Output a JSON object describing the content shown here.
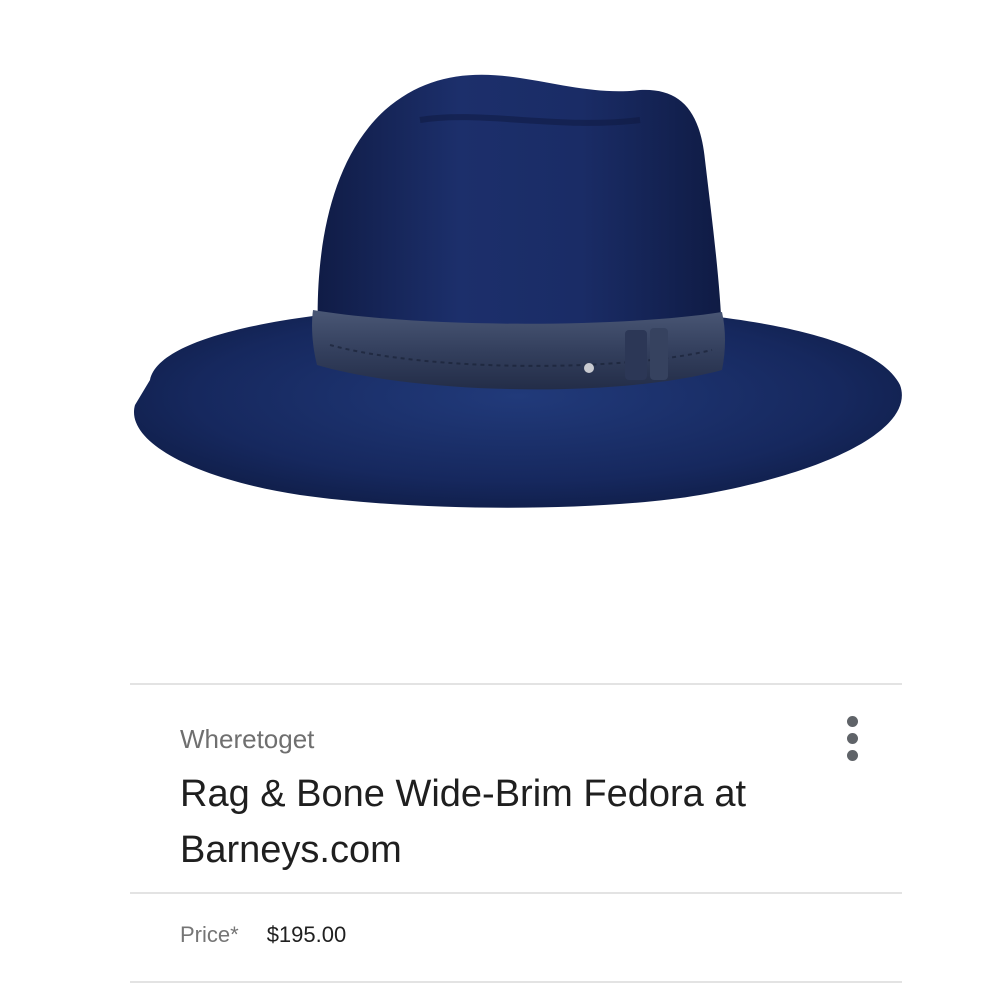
{
  "product": {
    "image_alt": "navy wide-brim fedora hat",
    "image_icon": "hat-image",
    "source": "Wheretoget",
    "title": "Rag & Bone Wide-Brim Fedora at Barneys.com",
    "more_icon": "more-vert-icon",
    "price_label": "Price*",
    "price_value": "$195.00"
  },
  "colors": {
    "hat": "#1b2a5e",
    "band": "#3a4764",
    "divider": "#e3e3e3"
  }
}
